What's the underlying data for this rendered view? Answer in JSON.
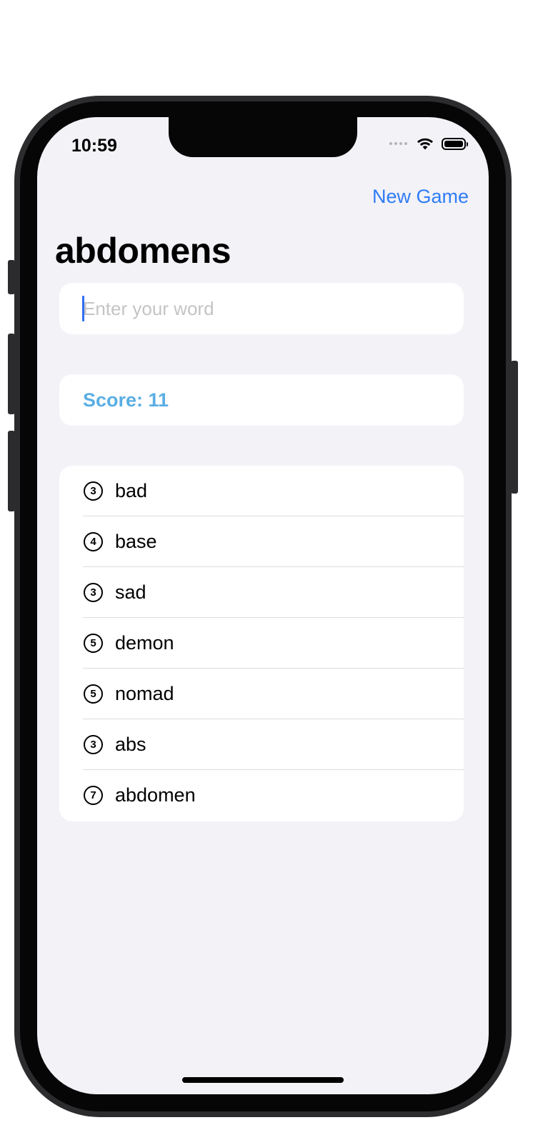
{
  "status_bar": {
    "time": "10:59"
  },
  "nav": {
    "new_game_label": "New Game"
  },
  "title": "abdomens",
  "word_input": {
    "value": "",
    "placeholder": "Enter your word"
  },
  "score": {
    "label": "Score: 11"
  },
  "words": [
    {
      "count": "3",
      "word": "bad"
    },
    {
      "count": "4",
      "word": "base"
    },
    {
      "count": "3",
      "word": "sad"
    },
    {
      "count": "5",
      "word": "demon"
    },
    {
      "count": "5",
      "word": "nomad"
    },
    {
      "count": "3",
      "word": "abs"
    },
    {
      "count": "7",
      "word": "abdomen"
    }
  ],
  "colors": {
    "accent": "#2f7cf6",
    "score": "#5aaee3",
    "background": "#f2f2f7"
  }
}
